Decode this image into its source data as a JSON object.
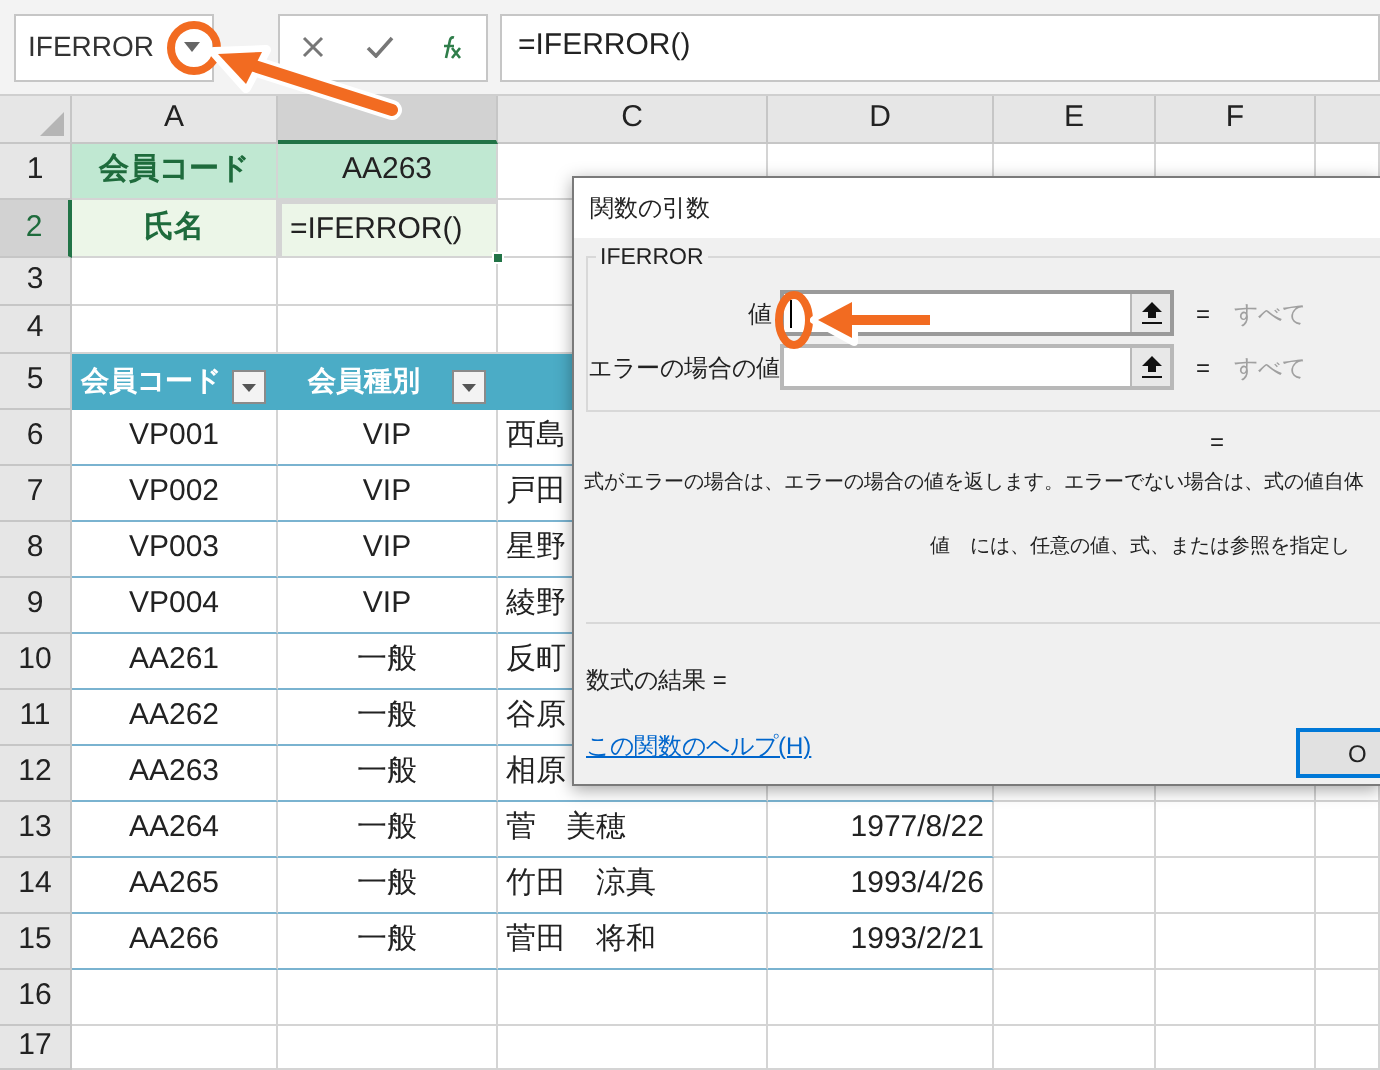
{
  "name_box": {
    "value": "IFERROR"
  },
  "formula_bar": {
    "value": "=IFERROR()"
  },
  "columns": [
    {
      "label": "A",
      "selected": false
    },
    {
      "selected": true
    },
    {
      "label": "C",
      "selected": false
    },
    {
      "label": "D",
      "selected": false
    },
    {
      "label": "E",
      "selected": false
    },
    {
      "label": "F",
      "selected": false
    }
  ],
  "rows": [
    {
      "number": "1",
      "selected": false,
      "kind": "lookup_header",
      "cells": [
        {
          "text": "会員コード",
          "active": false
        },
        {
          "text": "AA263",
          "active": false
        }
      ]
    },
    {
      "number": "2",
      "selected": true,
      "kind": "lookup_input",
      "cells": [
        {
          "text": "氏名",
          "active": false
        },
        {
          "text": "=IFERROR()",
          "active": true
        }
      ]
    },
    {
      "number": "3",
      "selected": false,
      "kind": "blank"
    },
    {
      "number": "4",
      "selected": false,
      "kind": "blank"
    },
    {
      "number": "5",
      "selected": false,
      "kind": "table_header",
      "cells": [
        "会員コード",
        "会員種別"
      ]
    },
    {
      "number": "6",
      "selected": false,
      "kind": "data",
      "cells": [
        "VP001",
        "VIP",
        "西島"
      ]
    },
    {
      "number": "7",
      "selected": false,
      "kind": "data",
      "cells": [
        "VP002",
        "VIP",
        "戸田"
      ]
    },
    {
      "number": "8",
      "selected": false,
      "kind": "data",
      "cells": [
        "VP003",
        "VIP",
        "星野"
      ]
    },
    {
      "number": "9",
      "selected": false,
      "kind": "data",
      "cells": [
        "VP004",
        "VIP",
        "綾野"
      ]
    },
    {
      "number": "10",
      "selected": false,
      "kind": "data",
      "cells": [
        "AA261",
        "一般",
        "反町"
      ]
    },
    {
      "number": "11",
      "selected": false,
      "kind": "data",
      "cells": [
        "AA262",
        "一般",
        "谷原"
      ]
    },
    {
      "number": "12",
      "selected": false,
      "kind": "data",
      "cells": [
        "AA263",
        "一般",
        "相原"
      ]
    },
    {
      "number": "13",
      "selected": false,
      "kind": "data",
      "cells": [
        "AA264",
        "一般",
        "菅　美穂",
        "1977/8/22"
      ]
    },
    {
      "number": "14",
      "selected": false,
      "kind": "data",
      "cells": [
        "AA265",
        "一般",
        "竹田　涼真",
        "1993/4/26"
      ]
    },
    {
      "number": "15",
      "selected": false,
      "kind": "data",
      "cells": [
        "AA266",
        "一般",
        "菅田　将和",
        "1993/2/21"
      ]
    },
    {
      "number": "16",
      "selected": false,
      "kind": "blank"
    },
    {
      "number": "17",
      "selected": false,
      "kind": "blank"
    }
  ],
  "dialog": {
    "title": "関数の引数",
    "function_name": "IFERROR",
    "arguments": [
      {
        "label": "値",
        "focused": true,
        "equals": "=",
        "result": "すべて"
      },
      {
        "label": "エラーの場合の値",
        "focused": false,
        "equals": "=",
        "result": "すべて"
      }
    ],
    "result_equals": "=",
    "description": "式がエラーの場合は、エラーの場合の値を返します。エラーでない場合は、式の値自体",
    "argument_name": "値",
    "argument_help": "には、任意の値、式、または参照を指定し",
    "formula_result": "数式の結果 =",
    "help_link": "この関数のヘルプ(H)",
    "ok_button": "O"
  }
}
